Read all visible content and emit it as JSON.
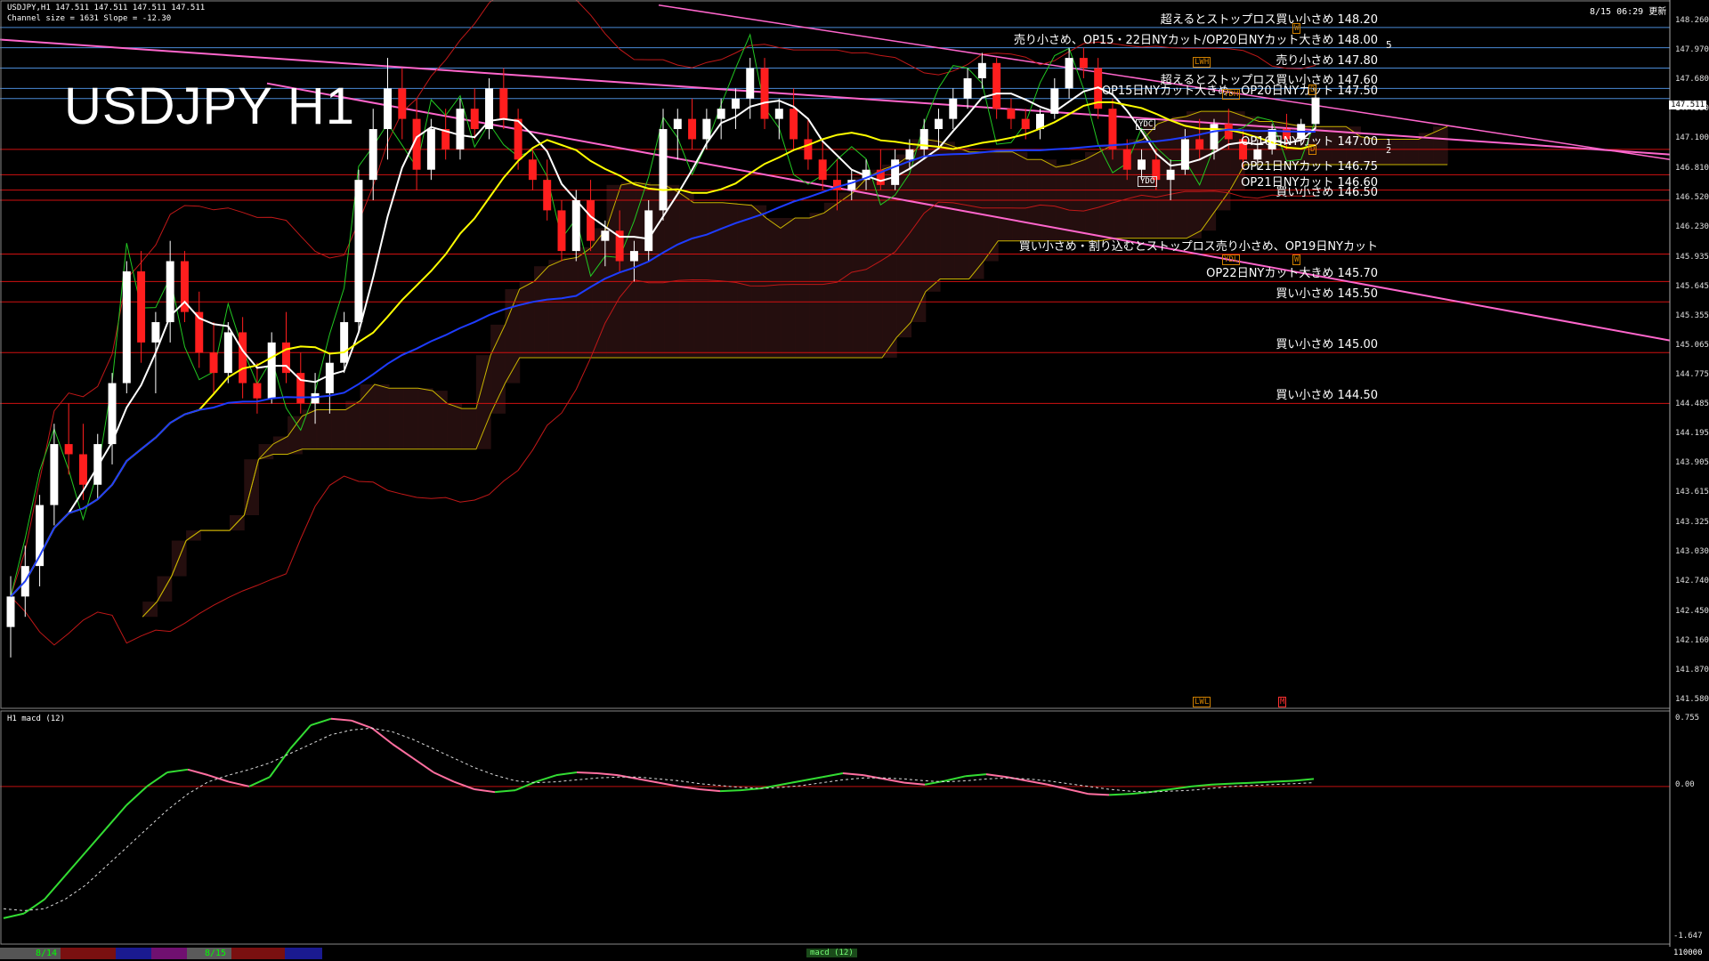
{
  "header": {
    "symbol_line": "USDJPY,H1 147.511 147.511 147.511 147.511",
    "channel_line": "Channel size = 1631 Slope = -12.30",
    "datetime": "8/15 06:29 更新",
    "big_title": "USDJPY H1"
  },
  "current_price": "147.511",
  "price_axis": [
    "148.260",
    "147.970",
    "147.680",
    "147.390",
    "147.100",
    "146.810",
    "146.520",
    "146.230",
    "145.935",
    "145.645",
    "145.355",
    "145.065",
    "144.775",
    "144.485",
    "144.195",
    "143.905",
    "143.615",
    "143.325",
    "143.030",
    "142.740",
    "142.450",
    "142.160",
    "141.870",
    "141.580"
  ],
  "macd_axis": {
    "top": "0.755",
    "zero": "0.00",
    "bottom": "-1.647"
  },
  "macd_label": "H1 macd (12)",
  "annotations": [
    {
      "text": "超えるとストップロス買い小さめ 148.20",
      "price": 148.2
    },
    {
      "text": "売り小さめ、OP15・22日NYカット/OP20日NYカット大きめ 148.00",
      "price": 148.0
    },
    {
      "text": "売り小さめ 147.80",
      "price": 147.8
    },
    {
      "text": "超えるとストップロス買い小さめ 147.60",
      "price": 147.6
    },
    {
      "text": "OP15日NYカット大きめ、OP20日NYカット 147.50",
      "price": 147.5
    },
    {
      "text": "OP16日NYカット 147.00",
      "price": 147.0
    },
    {
      "text": "OP21日NYカット 146.75",
      "price": 146.75
    },
    {
      "text": "OP21日NYカット 146.60",
      "price": 146.6
    },
    {
      "text": "買い小さめ 146.50",
      "price": 146.5
    },
    {
      "text": "買い小さめ・割り込むとストップロス売り小さめ、OP19日NYカット",
      "price": 145.97
    },
    {
      "text": "OP22日NYカット大きめ 145.70",
      "price": 145.7
    },
    {
      "text": "買い小さめ 145.50",
      "price": 145.5
    },
    {
      "text": "買い小さめ 145.00",
      "price": 145.0
    },
    {
      "text": "買い小さめ 144.50",
      "price": 144.5
    }
  ],
  "markers": {
    "YDH": "YDH",
    "YDC": "YDC",
    "YDO": "YDO",
    "YDL": "YDL",
    "LWH": "LWH",
    "LWL": "LWL",
    "W": "W",
    "D": "D",
    "M": "M",
    "five": "5",
    "one": "1",
    "two": "2"
  },
  "bottom_bar": {
    "date1": "8/14",
    "date2": "8/15",
    "macd_chip": "macd (12)",
    "right_num": "110000"
  },
  "colors": {
    "bull": "#ffffff",
    "bear": "#ff1e1e",
    "ma_white": "#ffffff",
    "ma_yellow": "#ffff00",
    "ma_blue": "#1e3cff",
    "green": "#22c822",
    "pink": "#ff66cc",
    "cloud": "#c81e1e",
    "hline_blue": "#4a8ad6",
    "hline_red": "#d01010"
  },
  "chart_data": {
    "type": "candlestick",
    "title": "USDJPY H1",
    "ylim": [
      141.5,
      148.4
    ],
    "macd_ylim": [
      -1.647,
      0.755
    ],
    "ohlc": [
      [
        142.3,
        142.8,
        142.0,
        142.6
      ],
      [
        142.6,
        143.1,
        142.4,
        142.9
      ],
      [
        142.9,
        143.6,
        142.7,
        143.5
      ],
      [
        143.5,
        144.3,
        143.3,
        144.1
      ],
      [
        144.1,
        144.5,
        143.8,
        144.0
      ],
      [
        144.0,
        144.3,
        143.55,
        143.7
      ],
      [
        143.7,
        144.2,
        143.55,
        144.1
      ],
      [
        144.1,
        144.8,
        143.9,
        144.7
      ],
      [
        144.7,
        145.9,
        144.6,
        145.8
      ],
      [
        145.8,
        146.0,
        144.9,
        145.1
      ],
      [
        145.1,
        145.4,
        144.6,
        145.3
      ],
      [
        145.3,
        146.1,
        145.1,
        145.9
      ],
      [
        145.9,
        146.0,
        145.3,
        145.4
      ],
      [
        145.4,
        145.6,
        144.85,
        145.0
      ],
      [
        145.0,
        145.3,
        144.6,
        144.8
      ],
      [
        144.8,
        145.3,
        144.7,
        145.2
      ],
      [
        145.2,
        145.35,
        144.55,
        144.7
      ],
      [
        144.7,
        144.9,
        144.4,
        144.55
      ],
      [
        144.55,
        145.2,
        144.5,
        145.1
      ],
      [
        145.1,
        145.4,
        144.7,
        144.8
      ],
      [
        144.8,
        145.0,
        144.4,
        144.5
      ],
      [
        144.5,
        144.8,
        144.3,
        144.6
      ],
      [
        144.6,
        145.0,
        144.4,
        144.9
      ],
      [
        144.9,
        145.4,
        144.8,
        145.3
      ],
      [
        145.3,
        146.8,
        145.2,
        146.7
      ],
      [
        146.7,
        147.4,
        146.5,
        147.2
      ],
      [
        147.2,
        147.9,
        146.9,
        147.6
      ],
      [
        147.6,
        147.8,
        147.1,
        147.3
      ],
      [
        147.3,
        147.5,
        146.6,
        146.8
      ],
      [
        146.8,
        147.3,
        146.7,
        147.2
      ],
      [
        147.2,
        147.4,
        146.9,
        147.0
      ],
      [
        147.0,
        147.5,
        146.9,
        147.4
      ],
      [
        147.4,
        147.6,
        147.1,
        147.2
      ],
      [
        147.2,
        147.7,
        147.1,
        147.6
      ],
      [
        147.6,
        147.8,
        147.2,
        147.3
      ],
      [
        147.3,
        147.4,
        146.8,
        146.9
      ],
      [
        146.9,
        147.0,
        146.6,
        146.7
      ],
      [
        146.7,
        146.9,
        146.3,
        146.4
      ],
      [
        146.4,
        146.5,
        145.9,
        146.0
      ],
      [
        146.0,
        146.6,
        145.9,
        146.5
      ],
      [
        146.5,
        146.7,
        146.0,
        146.1
      ],
      [
        146.1,
        146.3,
        145.85,
        146.2
      ],
      [
        146.2,
        146.4,
        145.8,
        145.9
      ],
      [
        145.9,
        146.1,
        145.7,
        146.0
      ],
      [
        146.0,
        146.5,
        145.9,
        146.4
      ],
      [
        146.4,
        147.4,
        146.3,
        147.2
      ],
      [
        147.2,
        147.4,
        146.9,
        147.3
      ],
      [
        147.3,
        147.5,
        147.0,
        147.1
      ],
      [
        147.1,
        147.4,
        147.0,
        147.3
      ],
      [
        147.3,
        147.5,
        147.1,
        147.4
      ],
      [
        147.4,
        147.6,
        147.2,
        147.5
      ],
      [
        147.5,
        147.9,
        147.3,
        147.8
      ],
      [
        147.8,
        147.9,
        147.2,
        147.3
      ],
      [
        147.3,
        147.5,
        147.1,
        147.4
      ],
      [
        147.4,
        147.6,
        147.0,
        147.1
      ],
      [
        147.1,
        147.3,
        146.8,
        146.9
      ],
      [
        146.9,
        147.1,
        146.6,
        146.7
      ],
      [
        146.7,
        146.9,
        146.4,
        146.6
      ],
      [
        146.6,
        146.8,
        146.5,
        146.7
      ],
      [
        146.7,
        146.9,
        146.6,
        146.8
      ],
      [
        146.8,
        147.0,
        146.6,
        146.65
      ],
      [
        146.65,
        147.0,
        146.6,
        146.9
      ],
      [
        146.9,
        147.1,
        146.8,
        147.0
      ],
      [
        147.0,
        147.3,
        146.9,
        147.2
      ],
      [
        147.2,
        147.4,
        147.0,
        147.3
      ],
      [
        147.3,
        147.6,
        147.2,
        147.5
      ],
      [
        147.5,
        147.8,
        147.4,
        147.7
      ],
      [
        147.7,
        147.95,
        147.6,
        147.85
      ],
      [
        147.85,
        147.9,
        147.3,
        147.4
      ],
      [
        147.4,
        147.5,
        147.2,
        147.3
      ],
      [
        147.3,
        147.4,
        147.1,
        147.2
      ],
      [
        147.2,
        147.4,
        147.1,
        147.35
      ],
      [
        147.35,
        147.7,
        147.3,
        147.6
      ],
      [
        147.6,
        148.0,
        147.5,
        147.9
      ],
      [
        147.9,
        148.0,
        147.7,
        147.8
      ],
      [
        147.8,
        147.9,
        147.3,
        147.4
      ],
      [
        147.4,
        147.5,
        146.9,
        147.0
      ],
      [
        147.0,
        147.1,
        146.7,
        146.8
      ],
      [
        146.8,
        147.0,
        146.7,
        146.9
      ],
      [
        146.9,
        147.0,
        146.6,
        146.7
      ],
      [
        146.7,
        146.9,
        146.5,
        146.8
      ],
      [
        146.8,
        147.2,
        146.75,
        147.1
      ],
      [
        147.1,
        147.3,
        146.9,
        147.0
      ],
      [
        147.0,
        147.3,
        146.9,
        147.25
      ],
      [
        147.25,
        147.4,
        147.0,
        147.1
      ],
      [
        147.1,
        147.2,
        146.8,
        146.9
      ],
      [
        146.9,
        147.1,
        146.8,
        147.0
      ],
      [
        147.0,
        147.25,
        146.95,
        147.2
      ],
      [
        147.2,
        147.35,
        147.0,
        147.1
      ],
      [
        147.1,
        147.3,
        147.05,
        147.25
      ],
      [
        147.25,
        147.6,
        147.2,
        147.51
      ]
    ],
    "macd": [
      -1.4,
      -1.35,
      -1.2,
      -0.95,
      -0.7,
      -0.45,
      -0.2,
      0.0,
      0.15,
      0.18,
      0.12,
      0.05,
      0.0,
      0.1,
      0.4,
      0.65,
      0.72,
      0.7,
      0.62,
      0.45,
      0.3,
      0.15,
      0.05,
      -0.03,
      -0.06,
      -0.04,
      0.05,
      0.12,
      0.15,
      0.14,
      0.12,
      0.08,
      0.04,
      0.0,
      -0.03,
      -0.05,
      -0.04,
      -0.02,
      0.02,
      0.06,
      0.1,
      0.14,
      0.12,
      0.08,
      0.04,
      0.02,
      0.06,
      0.11,
      0.13,
      0.1,
      0.06,
      0.02,
      -0.03,
      -0.08,
      -0.09,
      -0.08,
      -0.06,
      -0.03,
      0.0,
      0.02,
      0.03,
      0.04,
      0.05,
      0.06,
      0.08
    ],
    "macd_signal": [
      -1.3,
      -1.32,
      -1.3,
      -1.2,
      -1.05,
      -0.85,
      -0.65,
      -0.45,
      -0.25,
      -0.08,
      0.05,
      0.12,
      0.18,
      0.25,
      0.35,
      0.45,
      0.55,
      0.6,
      0.62,
      0.58,
      0.5,
      0.4,
      0.3,
      0.2,
      0.12,
      0.06,
      0.04,
      0.05,
      0.07,
      0.09,
      0.1,
      0.1,
      0.08,
      0.06,
      0.03,
      0.01,
      -0.01,
      -0.02,
      -0.01,
      0.01,
      0.04,
      0.07,
      0.09,
      0.09,
      0.08,
      0.06,
      0.05,
      0.06,
      0.08,
      0.09,
      0.08,
      0.06,
      0.03,
      0.0,
      -0.03,
      -0.05,
      -0.06,
      -0.05,
      -0.04,
      -0.02,
      0.0,
      0.01,
      0.02,
      0.03,
      0.04
    ]
  }
}
